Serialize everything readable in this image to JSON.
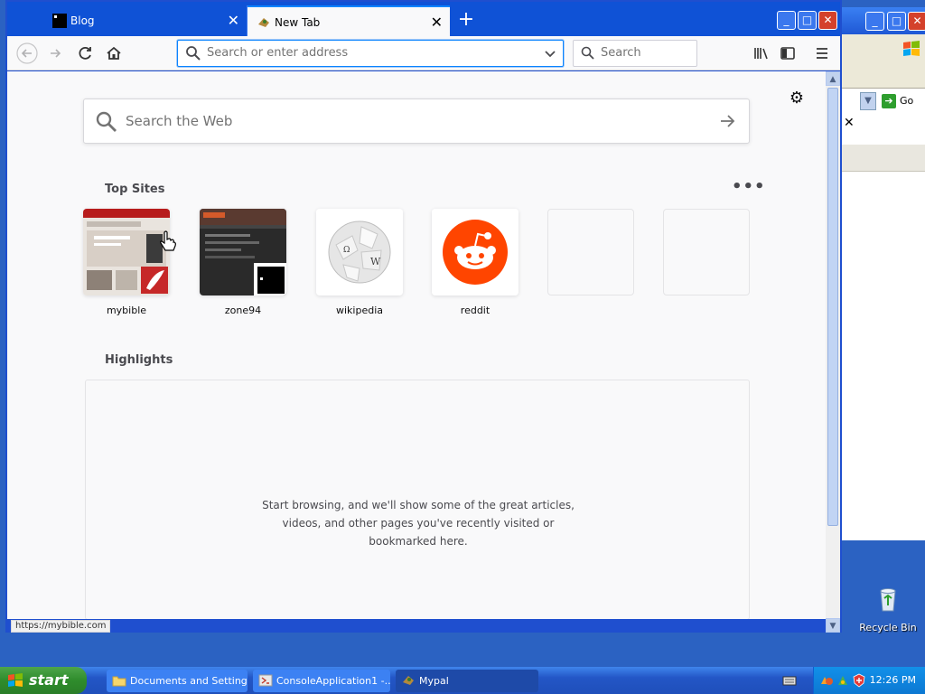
{
  "browser": {
    "tabs": [
      {
        "label": "Blog",
        "close": "✕"
      },
      {
        "label": "New Tab",
        "close": "✕"
      }
    ],
    "new_tab": "+",
    "window_controls": {
      "min": "_",
      "max": "□",
      "close": "✕"
    },
    "url_placeholder": "Search or enter address",
    "search_placeholder": "Search",
    "status_url": "https://mybible.com"
  },
  "newtab": {
    "web_search_placeholder": "Search the Web",
    "top_sites_title": "Top Sites",
    "more": "•••",
    "top_sites": [
      {
        "label": "mybible"
      },
      {
        "label": "zone94"
      },
      {
        "label": "wikipedia"
      },
      {
        "label": "reddit"
      },
      {
        "label": ""
      },
      {
        "label": ""
      }
    ],
    "highlights_title": "Highlights",
    "highlights_message": "Start browsing, and we'll show some of the great articles, videos, and other pages you've recently visited or bookmarked here."
  },
  "desktop": {
    "go_label": "Go",
    "recycle_bin": "Recycle Bin"
  },
  "taskbar": {
    "start_label": "start",
    "tasks": [
      {
        "label": "Documents and Settings"
      },
      {
        "label": "ConsoleApplication1 -..."
      },
      {
        "label": "Mypal"
      }
    ],
    "clock": "12:26 PM"
  },
  "colors": {
    "accent": "#0a84ff",
    "xp_blue": "#0f52d6",
    "reddit": "#ff4500",
    "start_green": "#2f8c2c"
  }
}
